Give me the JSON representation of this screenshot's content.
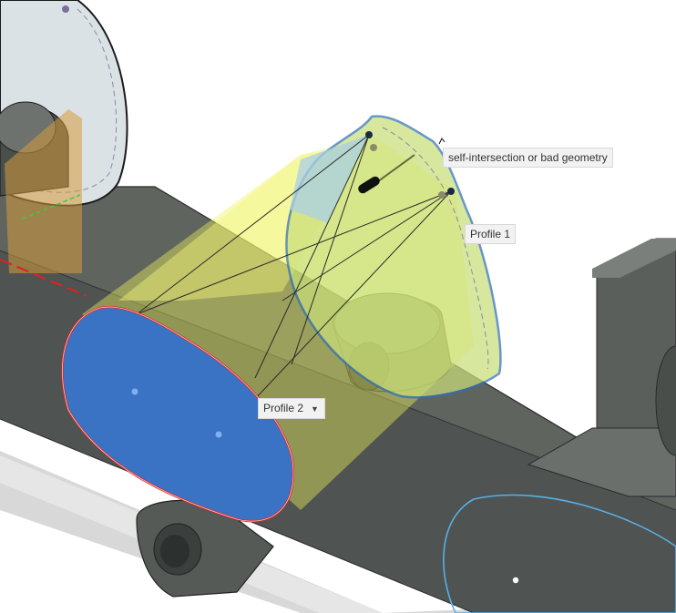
{
  "canvas": {
    "labels": {
      "warning": "self-intersection or bad geometry",
      "profile1": "Profile 1",
      "profile2": "Profile 2"
    },
    "icons": {
      "dropdown": "chevron-down-icon"
    },
    "colors": {
      "profile_fill": "#3a73c4",
      "loft_preview": "#e6ef5a",
      "body_dark": "#4e5250",
      "body_top": "#5e635f",
      "sketch_line": "#2f6fb8",
      "error_outline": "#e02020",
      "construction_plane": "#d59a3c",
      "background": "#ffffff"
    }
  }
}
